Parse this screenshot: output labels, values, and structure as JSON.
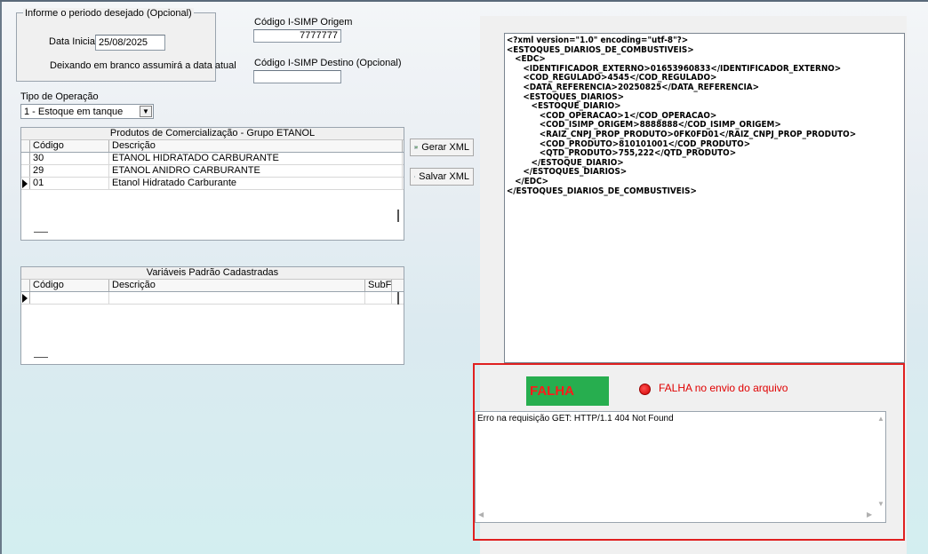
{
  "period": {
    "group_label": "Informe o periodo desejado (Opcional)",
    "start_label": "Data Inicial",
    "start_value": "25/08/2025",
    "hint": "Deixando em branco assumirá a data atual"
  },
  "origin": {
    "label": "Código  I-SIMP Origem",
    "value": "7777777"
  },
  "destination": {
    "label": "Código I-SIMP Destino   (Opcional)",
    "value": ""
  },
  "operation": {
    "label": "Tipo de Operação",
    "selected": "1 - Estoque em tanque"
  },
  "products_grid": {
    "title": "Produtos de Comercialização - Grupo ETANOL",
    "columns": [
      "Código",
      "Descrição"
    ],
    "rows": [
      {
        "code": "30",
        "desc": "ETANOL HIDRATADO CARBURANTE"
      },
      {
        "code": "29",
        "desc": "ETANOL ANIDRO CARBURANTE"
      },
      {
        "code": "01",
        "desc": "Etanol Hidratado Carburante"
      }
    ]
  },
  "variables_grid": {
    "title": "Variáveis Padrão Cadastradas",
    "columns": [
      "Código",
      "Descrição",
      "SubFo"
    ]
  },
  "buttons": {
    "generate_xml": "Gerar XML",
    "save_xml": "Salvar XML"
  },
  "xml_output": "<?xml version=\"1.0\" encoding=\"utf-8\"?>\n<ESTOQUES_DIARIOS_DE_COMBUSTIVEIS>\n   <EDC>\n      <IDENTIFICADOR_EXTERNO>01653960833</IDENTIFICADOR_EXTERNO>\n      <COD_REGULADO>4545</COD_REGULADO>\n      <DATA_REFERENCIA>20250825</DATA_REFERENCIA>\n      <ESTOQUES_DIARIOS>\n         <ESTOQUE_DIARIO>\n            <COD_OPERACAO>1</COD_OPERACAO>\n            <COD_ISIMP_ORIGEM>8888888</COD_ISIMP_ORIGEM>\n            <RAIZ_CNPJ_PROP_PRODUTO>0FK0FD01</RAIZ_CNPJ_PROP_PRODUTO>\n            <COD_PRODUTO>810101001</COD_PRODUTO>\n            <QTD_PRODUTO>755,222</QTD_PRODUTO>\n         </ESTOQUE_DIARIO>\n      </ESTOQUES_DIARIOS>\n   </EDC>\n</ESTOQUES_DIARIOS_DE_COMBUSTIVEIS>",
  "status": {
    "badge": "FALHA",
    "message": "FALHA no envio do arquivo",
    "badge_color": "#27ae4f",
    "text_color": "#e00000"
  },
  "error_text": "Erro na requisição GET: HTTP/1.1 404 Not Found"
}
